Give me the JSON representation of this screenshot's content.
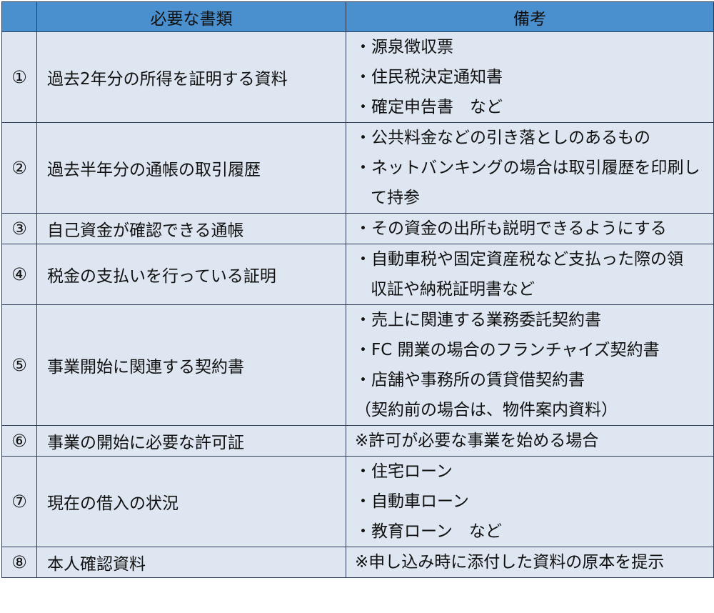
{
  "headers": {
    "number": "",
    "document": "必要な書類",
    "note": "備考"
  },
  "rows": [
    {
      "number": "①",
      "document": "過去2年分の所得を証明する資料",
      "notes": [
        "・源泉徴収票",
        "・住民税決定通知書",
        "・確定申告書　など"
      ]
    },
    {
      "number": "②",
      "document": "過去半年分の通帳の取引履歴",
      "notes": [
        "・公共料金などの引き落としのあるもの",
        "・ネットバンキングの場合は取引履歴を印刷し",
        "て持参"
      ]
    },
    {
      "number": "③",
      "document": "自己資金が確認できる通帳",
      "notes": [
        "・その資金の出所も説明できるようにする"
      ]
    },
    {
      "number": "④",
      "document": "税金の支払いを行っている証明",
      "notes": [
        "・自動車税や固定資産税など支払った際の領",
        "収証や納税証明書など"
      ]
    },
    {
      "number": "⑤",
      "document": "事業開始に関連する契約書",
      "notes": [
        "・売上に関連する業務委託契約書",
        "・FC 開業の場合のフランチャイズ契約書",
        "・店舗や事務所の賃貸借契約書",
        "（契約前の場合は、物件案内資料）"
      ]
    },
    {
      "number": "⑥",
      "document": "事業の開始に必要な許可証",
      "notes": [
        "※許可が必要な事業を始める場合"
      ]
    },
    {
      "number": "⑦",
      "document": "現在の借入の状況",
      "notes": [
        "・住宅ローン",
        "・自動車ローン",
        "・教育ローン　など"
      ]
    },
    {
      "number": "⑧",
      "document": "本人確認資料",
      "notes": [
        "※申し込み時に添付した資料の原本を提示"
      ]
    }
  ]
}
